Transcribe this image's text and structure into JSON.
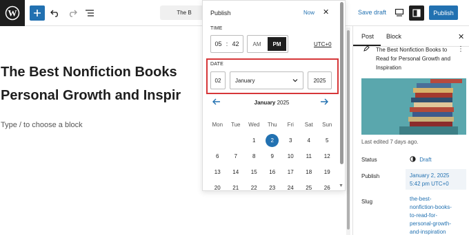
{
  "toolbar": {
    "title_pill": "The B",
    "save_draft": "Save draft",
    "publish": "Publish"
  },
  "canvas": {
    "title_line1": "The Best Nonfiction Books",
    "title_line2": "Personal Growth and Inspir",
    "block_hint": "Type / to choose a block"
  },
  "popover": {
    "title": "Publish",
    "now": "Now",
    "time_label": "TIME",
    "hour": "05",
    "minute": "42",
    "am": "AM",
    "pm": "PM",
    "utc": "UTC+0",
    "date_label": "DATE",
    "day": "02",
    "month": "January",
    "year": "2025",
    "cal_month": "January",
    "cal_year": "2025",
    "weekdays": [
      "Mon",
      "Tue",
      "Wed",
      "Thu",
      "Fri",
      "Sat",
      "Sun"
    ],
    "weeks": [
      [
        "",
        "",
        "1",
        "2",
        "3",
        "4",
        "5"
      ],
      [
        "6",
        "7",
        "8",
        "9",
        "10",
        "11",
        "12"
      ],
      [
        "13",
        "14",
        "15",
        "16",
        "17",
        "18",
        "19"
      ],
      [
        "20",
        "21",
        "22",
        "23",
        "24",
        "25",
        "26"
      ]
    ],
    "selected_day": "2"
  },
  "sidebar": {
    "tab_post": "Post",
    "tab_block": "Block",
    "post_title": "The Best Nonfiction Books to Read for Personal Growth and Inspiration",
    "last_edited": "Last edited 7 days ago.",
    "status_label": "Status",
    "status_value": "Draft",
    "publish_label": "Publish",
    "publish_value_line1": "January 2, 2025",
    "publish_value_line2": "5:42 pm UTC+0",
    "slug_label": "Slug",
    "slug_lines": [
      "the-best-",
      "nonfiction-books-",
      "to-read-for-",
      "personal-growth-",
      "and-inspiration"
    ]
  },
  "colors": {
    "accent": "#2271b1",
    "highlight": "#d63638",
    "dark": "#1e1e1e"
  }
}
